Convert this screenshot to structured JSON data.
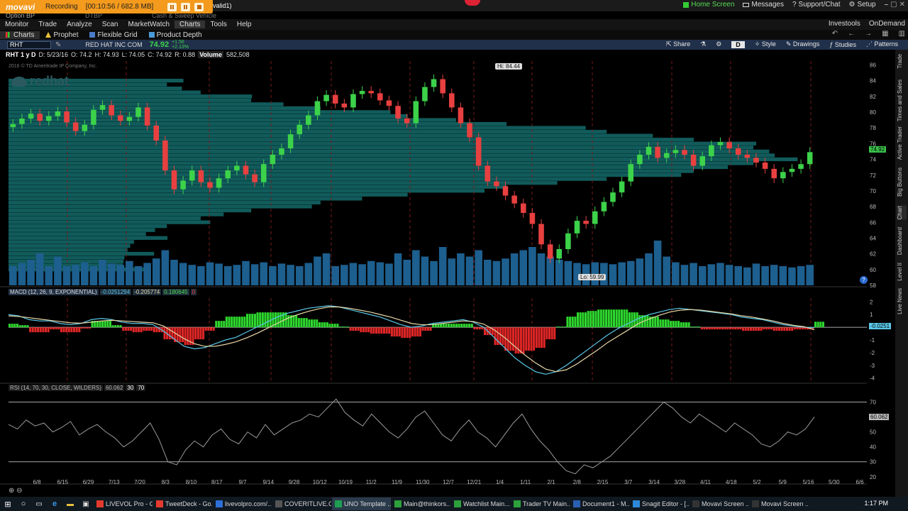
{
  "recorder": {
    "brand": "movavi",
    "status": "Recording",
    "timer": "[00:10:56 / 682.8 MB]"
  },
  "account": {
    "label": "Option BP",
    "tabs": [
      "DTBP",
      "Cash & Sweep Vehicle"
    ],
    "name_fragment": "valid1)"
  },
  "top_right": [
    "Home Screen",
    "Messages",
    "Support/Chat",
    "Setup"
  ],
  "menu": {
    "items": [
      "Monitor",
      "Trade",
      "Analyze",
      "Scan",
      "MarketWatch",
      "Charts",
      "Tools",
      "Help"
    ],
    "active": "Charts",
    "right": [
      "Investools",
      "OnDemand"
    ]
  },
  "submenu": {
    "items": [
      "Charts",
      "Prophet",
      "Flexible Grid",
      "Product Depth"
    ],
    "active": "Charts"
  },
  "toolbar": {
    "symbol": "RHT",
    "company": "RED HAT INC COM",
    "price": "74.92",
    "change": "+1.56",
    "change_pct": "+2.13%",
    "aggregation": "D",
    "buttons": [
      "Share",
      "Style",
      "Drawings",
      "Studies",
      "Patterns"
    ]
  },
  "info": {
    "symbol": "RHT 1 y D",
    "date": "D: 5/23/16",
    "open": "O: 74.2",
    "high": "H: 74.93",
    "low": "L: 74.05",
    "close": "C: 74.92",
    "range": "R: 0.88",
    "volume_label": "Volume",
    "volume_value": "582,508"
  },
  "watermark": {
    "copyright": "2016 © TD Ameritrade IP Company, Inc.",
    "logo": "redhat"
  },
  "hi_label": "Hi: 84.44",
  "lo_label": "Lo: 59.99",
  "macd": {
    "title": "MACD (12, 26, 9, EXPONENTIAL)",
    "v1": "-0.0251294",
    "v2": "-0.205774",
    "v3": "0.180645",
    "v4": "0",
    "badge": "-0.0251"
  },
  "rsi": {
    "title": "RSI (14, 70, 30, CLOSE, WILDERS)",
    "v1": "60.062",
    "v2": "30",
    "v3": "70",
    "badge": "60.062"
  },
  "price_badge": "74.92",
  "side_tabs": [
    "Trade",
    "Times and Sales",
    "Active Trader",
    "Big Buttons",
    "Chart",
    "Dashboard",
    "Level II",
    "Live News"
  ],
  "taskbar": [
    {
      "label": "LIVEVOL Pro - G...",
      "color": "#e33b2e"
    },
    {
      "label": "TweetDeck - Go...",
      "color": "#e33b2e"
    },
    {
      "label": "livevolpro.com/...",
      "color": "#2d6fd8"
    },
    {
      "label": "COVERITLIVE.C...",
      "color": "#555555"
    },
    {
      "label": "UNO Template ...",
      "color": "#1e9e52"
    },
    {
      "label": "Main@thinkors...",
      "color": "#2ca03c"
    },
    {
      "label": "Watchlist Main...",
      "color": "#2ca03c"
    },
    {
      "label": "Trader TV Main...",
      "color": "#2ca03c"
    },
    {
      "label": "Document1 - M...",
      "color": "#2b5fb4"
    },
    {
      "label": "Snagit Editor - [...",
      "color": "#2e8ad8"
    },
    {
      "label": "Movavi Screen ...",
      "color": "#333333"
    },
    {
      "label": "Movavi Screen ...",
      "color": "#333333"
    }
  ],
  "clock": "1:17 PM",
  "chart_data": [
    {
      "type": "line",
      "subtype": "candlestick",
      "xlabel": "",
      "ylabel": "",
      "x_ticks": [
        "6/8",
        "6/15",
        "6/29",
        "7/13",
        "7/20",
        "8/3",
        "8/10",
        "8/17",
        "9/7",
        "9/14",
        "9/28",
        "10/12",
        "10/19",
        "11/2",
        "11/9",
        "11/30",
        "12/7",
        "12/21",
        "1/4",
        "1/11",
        "2/1",
        "2/8",
        "2/15",
        "3/7",
        "3/14",
        "3/28",
        "4/11",
        "4/18",
        "5/2",
        "5/9",
        "5/16",
        "5/30",
        "6/6"
      ],
      "y_ticks": [
        58,
        60,
        62,
        64,
        66,
        68,
        70,
        72,
        74,
        76,
        78,
        80,
        82,
        84,
        86
      ],
      "ylim": [
        58,
        86.5
      ],
      "series": [
        {
          "values": [
            78.5,
            79.2,
            79.8,
            78.9,
            79.5,
            80.1,
            78.7,
            77.6,
            78.4,
            80.3,
            80.9,
            79.6,
            78.9,
            79.4,
            80.6,
            78.3,
            76.4,
            72.6,
            70.2,
            71.3,
            72.6,
            71.1,
            70.4,
            71.6,
            72.6,
            73.2,
            72.1,
            71.1,
            73.4,
            74.6,
            75.4,
            77.2,
            78.4,
            79.6,
            81.4,
            82.2,
            81.1,
            80.6,
            82.3,
            82.7,
            82.4,
            81.5,
            80.8,
            79.2,
            78.6,
            81.4,
            83.2,
            84.2,
            82.4,
            80.6,
            78.6,
            76.8,
            73.2,
            71.2,
            70.6,
            69.4,
            68.4,
            67.2,
            65.8,
            63.2,
            61.4,
            62.6,
            64.6,
            66.2,
            65.8,
            67.4,
            68.6,
            69.8,
            71.2,
            73.4,
            74.6,
            75.6,
            74.2,
            74.8,
            75.2,
            74.6,
            73.2,
            74.4,
            75.8,
            76.2,
            75.4,
            74.6,
            74.2,
            73.6,
            72.8,
            71.6,
            72.4,
            72.8,
            73.4,
            74.92
          ]
        }
      ],
      "hi": 84.44,
      "lo": 59.99
    },
    {
      "type": "bar",
      "title": "Volume",
      "values": [
        0.3,
        0.35,
        0.4,
        0.5,
        0.3,
        0.45,
        0.3,
        0.32,
        0.36,
        0.3,
        0.4,
        0.34,
        0.32,
        0.38,
        0.3,
        0.35,
        0.42,
        0.55,
        0.4,
        0.35,
        0.32,
        0.3,
        0.36,
        0.34,
        0.3,
        0.32,
        0.38,
        0.33,
        0.36,
        0.3,
        0.34,
        0.32,
        0.3,
        0.35,
        0.45,
        0.5,
        0.3,
        0.32,
        0.35,
        0.33,
        0.38,
        0.36,
        0.34,
        0.5,
        0.4,
        0.55,
        0.45,
        0.38,
        0.6,
        0.42,
        0.5,
        0.45,
        0.55,
        0.4,
        0.38,
        0.42,
        0.5,
        0.55,
        0.6,
        0.5,
        0.45,
        0.4,
        0.38,
        0.35,
        0.33,
        0.36,
        0.35,
        0.33,
        0.36,
        0.38,
        0.42,
        0.5,
        0.7,
        0.45,
        0.36,
        0.32,
        0.35,
        0.3,
        0.33,
        0.35,
        0.32,
        0.3,
        0.28,
        0.34,
        0.3,
        0.32,
        0.3,
        0.28,
        0.3,
        0.32
      ]
    },
    {
      "type": "line",
      "title": "MACD (12, 26, 9, EXPONENTIAL)",
      "y_ticks": [
        2,
        1,
        0,
        -1,
        -2,
        -3,
        -4
      ],
      "ylim": [
        -4.3,
        2.3
      ],
      "series": [
        {
          "values": [
            1.0,
            0.9,
            0.6,
            0.5,
            0.5,
            0.3,
            0.2,
            0.3,
            0.6,
            0.7,
            0.6,
            0.4,
            0.3,
            0.3,
            0.2,
            -0.3,
            -0.9,
            -1.5,
            -1.7,
            -1.6,
            -1.3,
            -1.0,
            -0.8,
            -0.4,
            0.0,
            0.4,
            0.8,
            1.1,
            1.3,
            1.5,
            1.6,
            1.7,
            1.6,
            1.4,
            1.2,
            1.0,
            0.8,
            0.5,
            0.2,
            0.0,
            0.1,
            0.3,
            0.4,
            0.5,
            0.6,
            0.4,
            0.0,
            -0.8,
            -1.6,
            -2.4,
            -3.0,
            -3.5,
            -3.7,
            -3.5,
            -3.0,
            -2.4,
            -1.8,
            -1.2,
            -0.6,
            -0.1,
            0.3,
            0.7,
            1.0,
            1.2,
            1.4,
            1.5,
            1.4,
            1.3,
            1.2,
            1.1,
            1.0,
            0.8,
            0.7,
            0.6,
            0.4,
            0.2,
            0.1,
            0.0,
            -0.03
          ]
        },
        {
          "values": [
            0.9,
            0.85,
            0.75,
            0.65,
            0.55,
            0.45,
            0.35,
            0.32,
            0.4,
            0.5,
            0.55,
            0.5,
            0.45,
            0.4,
            0.35,
            0.1,
            -0.4,
            -0.9,
            -1.3,
            -1.5,
            -1.5,
            -1.35,
            -1.15,
            -0.85,
            -0.5,
            -0.1,
            0.3,
            0.7,
            1.0,
            1.25,
            1.45,
            1.6,
            1.6,
            1.5,
            1.35,
            1.2,
            1.0,
            0.8,
            0.55,
            0.3,
            0.2,
            0.2,
            0.3,
            0.4,
            0.5,
            0.45,
            0.25,
            -0.2,
            -0.8,
            -1.5,
            -2.2,
            -2.8,
            -3.3,
            -3.5,
            -3.35,
            -2.9,
            -2.35,
            -1.8,
            -1.2,
            -0.7,
            -0.2,
            0.3,
            0.65,
            0.95,
            1.2,
            1.35,
            1.4,
            1.35,
            1.25,
            1.15,
            1.05,
            0.9,
            0.8,
            0.65,
            0.5,
            0.3,
            0.15,
            0.05,
            -0.2
          ]
        }
      ]
    },
    {
      "type": "line",
      "title": "RSI (14, 70, 30, CLOSE, WILDERS)",
      "y_ticks": [
        70,
        60,
        50,
        40,
        30,
        20
      ],
      "ylim": [
        18,
        75
      ],
      "series": [
        {
          "values": [
            55,
            52,
            58,
            54,
            56,
            50,
            53,
            57,
            48,
            52,
            55,
            50,
            46,
            40,
            44,
            50,
            56,
            45,
            30,
            28,
            38,
            44,
            40,
            48,
            52,
            45,
            42,
            50,
            46,
            55,
            48,
            52,
            56,
            58,
            62,
            60,
            66,
            72,
            63,
            58,
            54,
            62,
            56,
            50,
            46,
            52,
            60,
            64,
            56,
            48,
            44,
            52,
            58,
            50,
            46,
            40,
            48,
            56,
            62,
            52,
            44,
            38,
            30,
            24,
            22,
            28,
            26,
            30,
            34,
            40,
            46,
            52,
            58,
            64,
            70,
            66,
            60,
            56,
            62,
            58,
            54,
            50,
            56,
            52,
            48,
            42,
            40,
            44,
            50,
            48,
            52,
            60.06
          ]
        }
      ]
    }
  ]
}
